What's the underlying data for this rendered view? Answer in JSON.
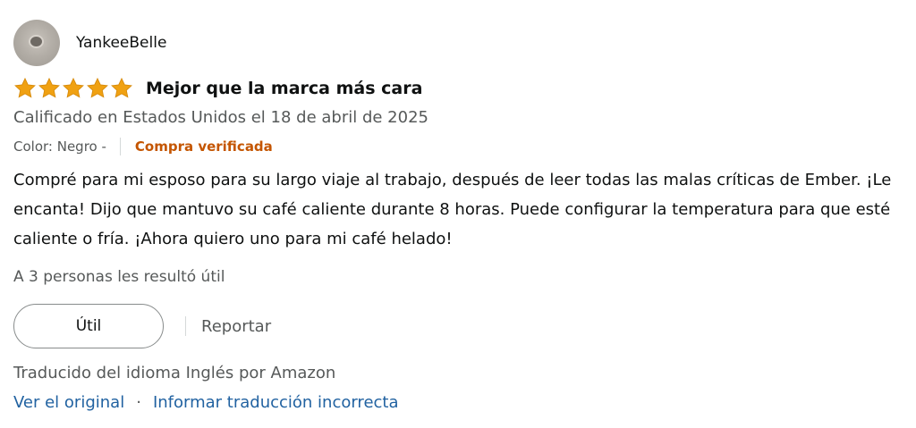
{
  "review": {
    "profile_name": "YankeeBelle",
    "rating": 5,
    "rating_max": 5,
    "title": "Mejor que la marca más cara",
    "date_text": "Calificado en Estados Unidos el 18 de abril de 2025",
    "variant": "Color: Negro -",
    "verified_label": "Compra verificada",
    "body": "Compré para mi esposo para su largo viaje al trabajo, después de leer todas las malas críticas de Ember. ¡Le encanta! Dijo que mantuvo su café caliente durante 8 horas. Puede configurar la temperatura para que esté caliente o fría. ¡Ahora quiero uno para mi café helado!",
    "helpful_text": "A 3 personas les resultó útil",
    "useful_button": "Útil",
    "report_label": "Reportar",
    "translation_note": "Traducido del idioma Inglés por Amazon",
    "view_original_label": "Ver el original",
    "separator": "·",
    "report_translation_label": "Informar traducción incorrecta"
  },
  "colors": {
    "star": "#f0a112",
    "verified": "#c45500",
    "link": "#2162a1",
    "secondary_text": "#565959"
  },
  "icons": {
    "avatar": "profile-avatar-icon",
    "star": "star-icon"
  }
}
